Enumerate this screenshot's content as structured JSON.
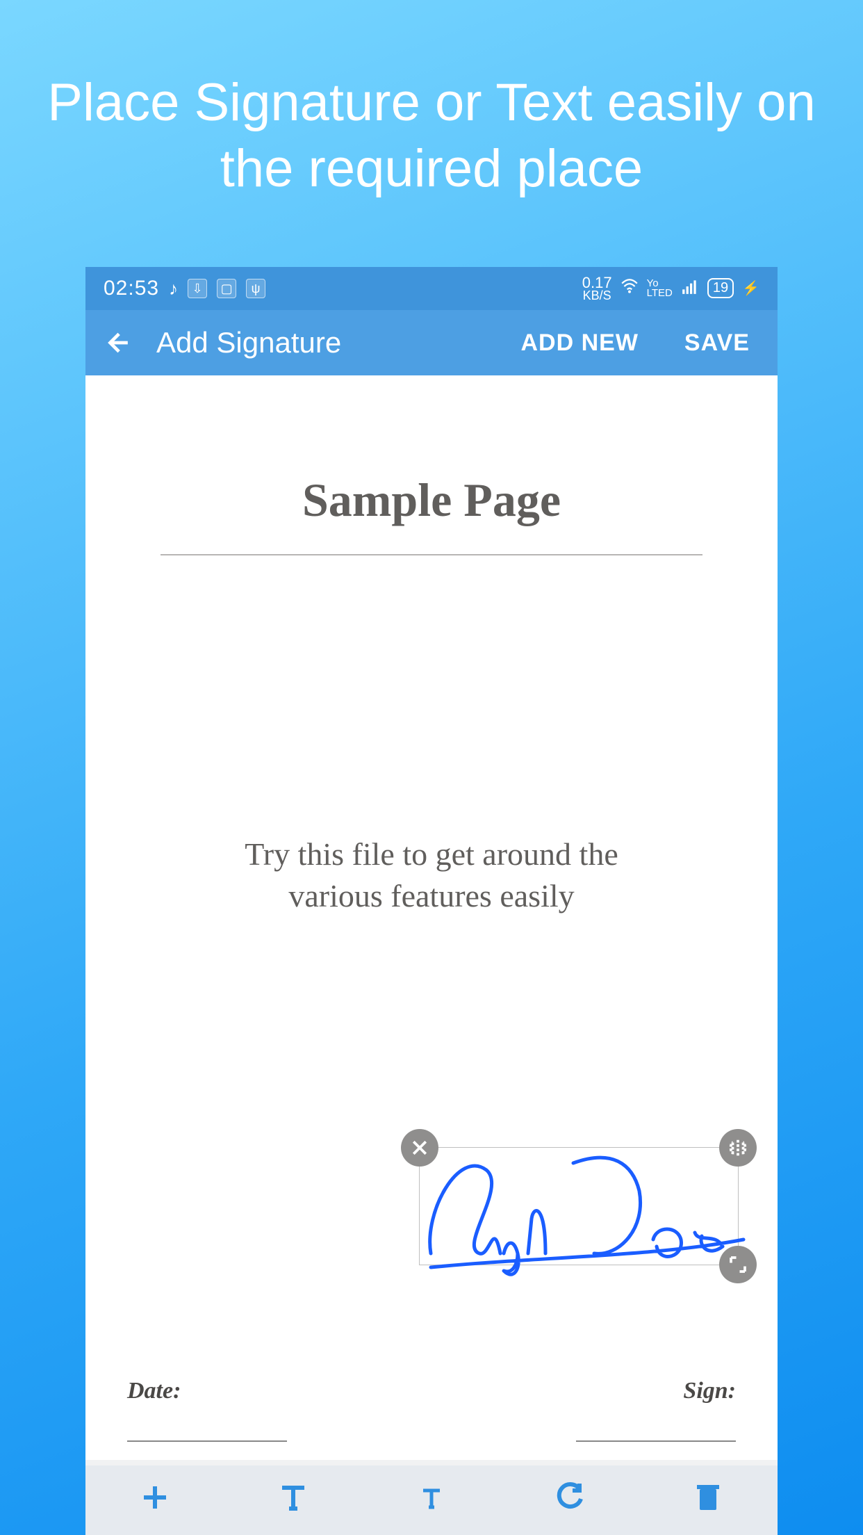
{
  "promo": {
    "line1": "Place Signature or Text easily on",
    "line2": "the required place"
  },
  "statusbar": {
    "time": "02:53",
    "speed_value": "0.17",
    "speed_unit": "KB/S",
    "volte": "Vo LTE",
    "battery": "19"
  },
  "appbar": {
    "title": "Add Signature",
    "add_new": "ADD NEW",
    "save": "SAVE"
  },
  "document": {
    "title": "Sample Page",
    "body_line1": "Try this file to get around the",
    "body_line2": "various features easily",
    "date_label": "Date:",
    "sign_label": "Sign:"
  },
  "signature": {
    "text": "Sign Doc"
  },
  "colors": {
    "accent": "#4d9fe3",
    "ink": "#1a5dff"
  }
}
